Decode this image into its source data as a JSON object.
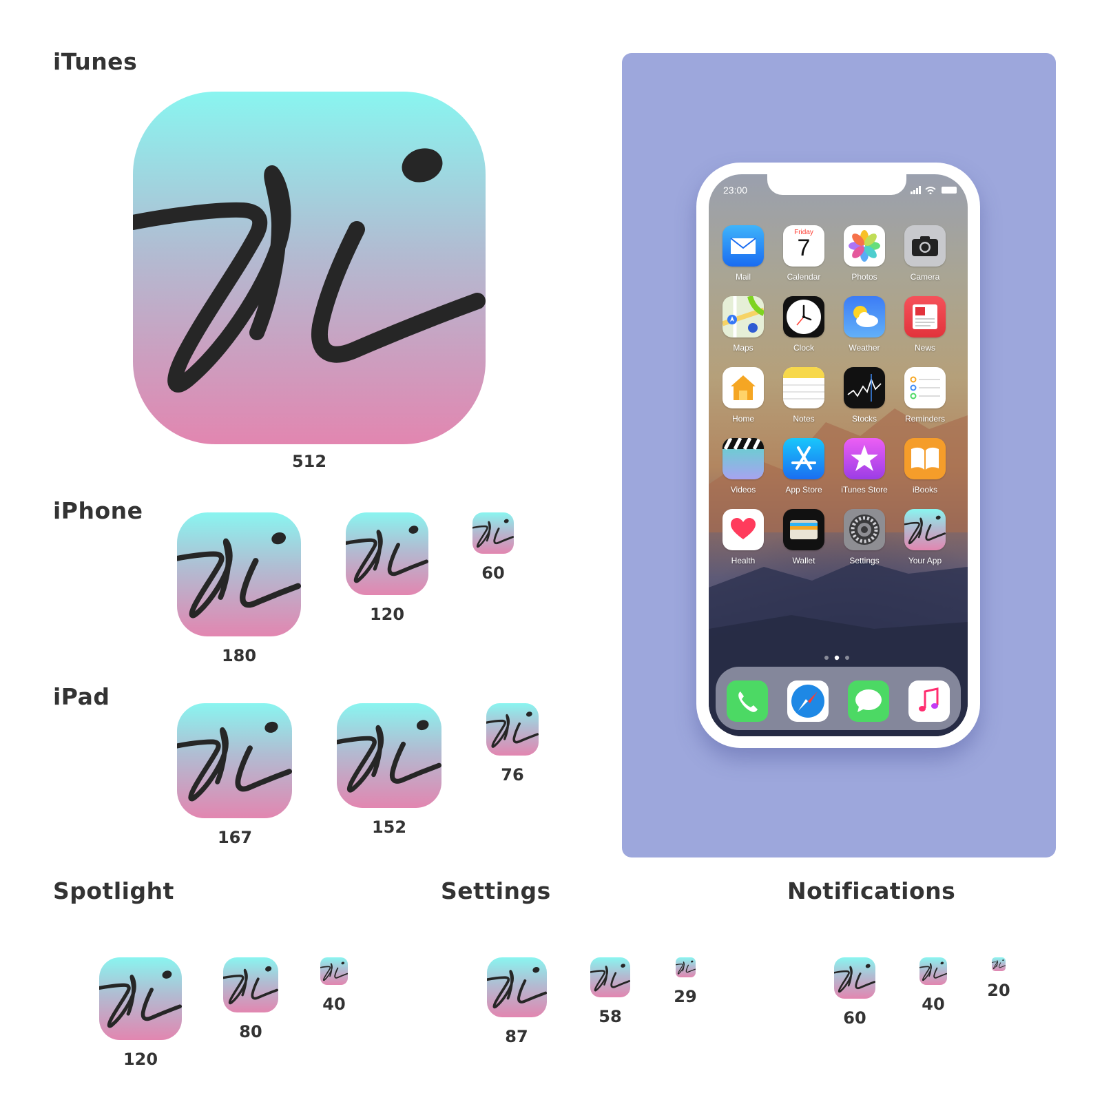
{
  "sections": {
    "itunes": "iTunes",
    "iphone": "iPhone",
    "ipad": "iPad",
    "spotlight": "Spotlight",
    "settings": "Settings",
    "notifications": "Notifications"
  },
  "sizes": {
    "itunes": [
      "512"
    ],
    "iphone": [
      "180",
      "120",
      "60"
    ],
    "ipad": [
      "167",
      "152",
      "76"
    ],
    "spotlight": [
      "120",
      "80",
      "40"
    ],
    "settings": [
      "87",
      "58",
      "29"
    ],
    "notifications": [
      "60",
      "40",
      "20"
    ]
  },
  "phone": {
    "time": "23:00",
    "calendar_day": "Friday",
    "calendar_date": "7",
    "apps": [
      {
        "label": "Mail",
        "icon": "mail-icon"
      },
      {
        "label": "Calendar",
        "icon": "calendar-icon"
      },
      {
        "label": "Photos",
        "icon": "photos-icon"
      },
      {
        "label": "Camera",
        "icon": "camera-icon"
      },
      {
        "label": "Maps",
        "icon": "maps-icon"
      },
      {
        "label": "Clock",
        "icon": "clock-icon"
      },
      {
        "label": "Weather",
        "icon": "weather-icon"
      },
      {
        "label": "News",
        "icon": "news-icon"
      },
      {
        "label": "Home",
        "icon": "home-icon"
      },
      {
        "label": "Notes",
        "icon": "notes-icon"
      },
      {
        "label": "Stocks",
        "icon": "stocks-icon"
      },
      {
        "label": "Reminders",
        "icon": "reminders-icon"
      },
      {
        "label": "Videos",
        "icon": "videos-icon"
      },
      {
        "label": "App Store",
        "icon": "app-store-icon"
      },
      {
        "label": "iTunes Store",
        "icon": "itunes-store-icon"
      },
      {
        "label": "iBooks",
        "icon": "ibooks-icon"
      },
      {
        "label": "Health",
        "icon": "health-icon"
      },
      {
        "label": "Wallet",
        "icon": "wallet-icon"
      },
      {
        "label": "Settings",
        "icon": "settings-icon"
      },
      {
        "label": "Your App",
        "icon": "vi-logo-icon"
      }
    ],
    "dock": [
      "phone-icon",
      "safari-icon",
      "messages-icon",
      "music-icon"
    ]
  },
  "colors": {
    "icon_gradient_top": "#89f5f0",
    "icon_gradient_bottom": "#e286b0",
    "logo_ink": "#262626",
    "panel_bg": "#9da7dc"
  }
}
